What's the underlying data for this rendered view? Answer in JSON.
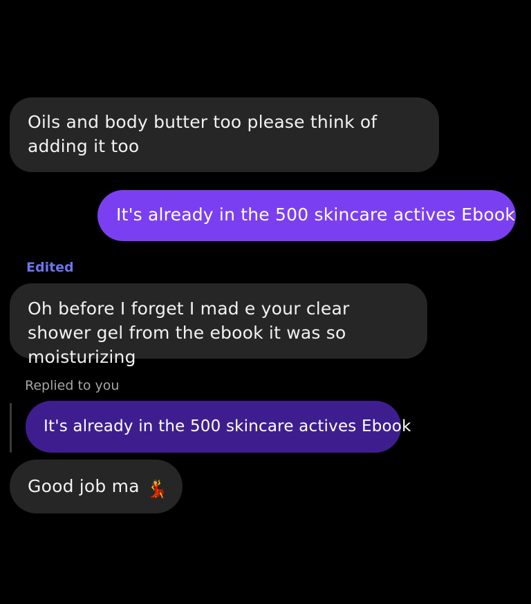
{
  "messages": [
    {
      "direction": "incoming",
      "text": "Oils and body butter too please think of adding it too"
    },
    {
      "direction": "outgoing",
      "text": "It's already in the 500 skincare actives Ebook"
    },
    {
      "direction": "incoming",
      "label": "Edited",
      "text": "Oh before I forget I mad e your clear shower gel from the ebook it was so moisturizing"
    },
    {
      "direction": "incoming",
      "reply_label": "Replied to you",
      "quoted_text": "It's already in the 500 skincare actives Ebook",
      "text": "Good job ma",
      "emoji": "💃",
      "emoji_icon": "dancing-woman-icon"
    }
  ],
  "colors": {
    "background": "#000000",
    "incoming_bubble": "#262626",
    "outgoing_bubble": "#7b3ff2",
    "reply_quote_bubble": "#3e1e8f",
    "edited_label": "#6d74f0",
    "replied_label": "#a6a6a6"
  }
}
